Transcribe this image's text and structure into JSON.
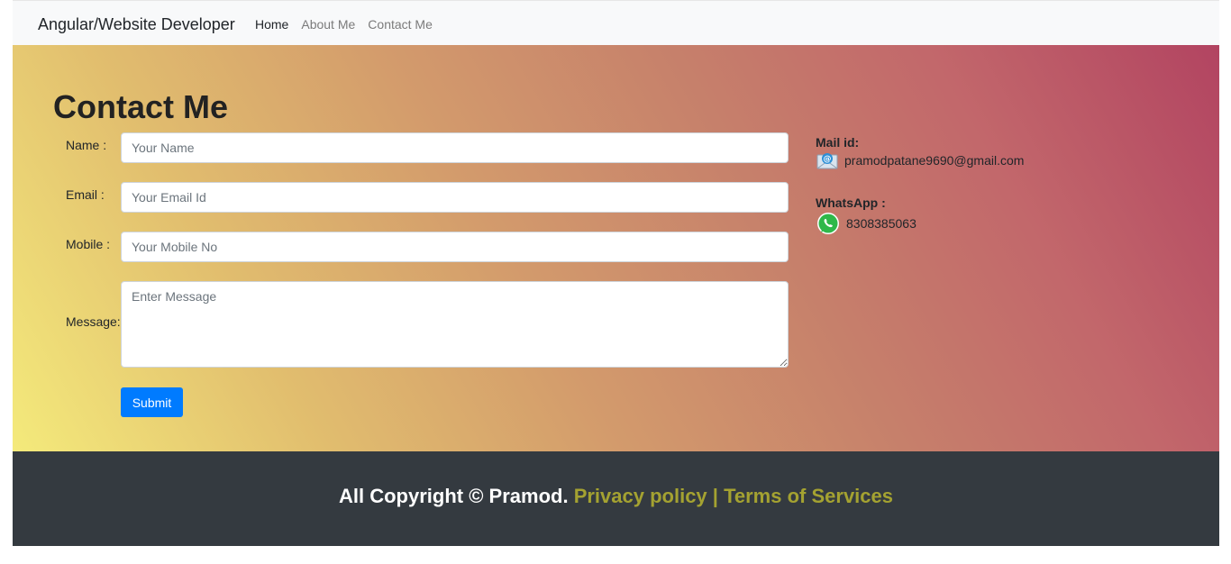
{
  "navbar": {
    "brand": "Angular/Website Developer",
    "links": [
      {
        "label": "Home",
        "active": true
      },
      {
        "label": "About Me",
        "active": false
      },
      {
        "label": "Contact Me",
        "active": false
      }
    ]
  },
  "contact": {
    "title": "Contact Me",
    "fields": {
      "name": {
        "label": "Name :",
        "placeholder": "Your Name",
        "value": ""
      },
      "email": {
        "label": "Email :",
        "placeholder": "Your Email Id",
        "value": ""
      },
      "mobile": {
        "label": "Mobile :",
        "placeholder": "Your Mobile No",
        "value": ""
      },
      "message": {
        "label": "Message:",
        "placeholder": "Enter Message",
        "value": ""
      }
    },
    "submit_label": "Submit"
  },
  "info": {
    "mail": {
      "heading": "Mail id:",
      "value": "pramodpatane9690@gmail.com",
      "icon": "mail-icon"
    },
    "whatsapp": {
      "heading": "WhatsApp :",
      "value": "8308385063",
      "icon": "whatsapp-icon"
    }
  },
  "footer": {
    "copyright": "All Copyright © Pramod.",
    "privacy": "Privacy policy",
    "separator": "|",
    "terms": "Terms of Services"
  },
  "colors": {
    "navbar_bg": "#f8f9fa",
    "footer_bg": "#343a40",
    "footer_link": "#a4a231",
    "button": "#007bff",
    "gradient_start": "#f4ea7b",
    "gradient_end": "#b24461"
  }
}
